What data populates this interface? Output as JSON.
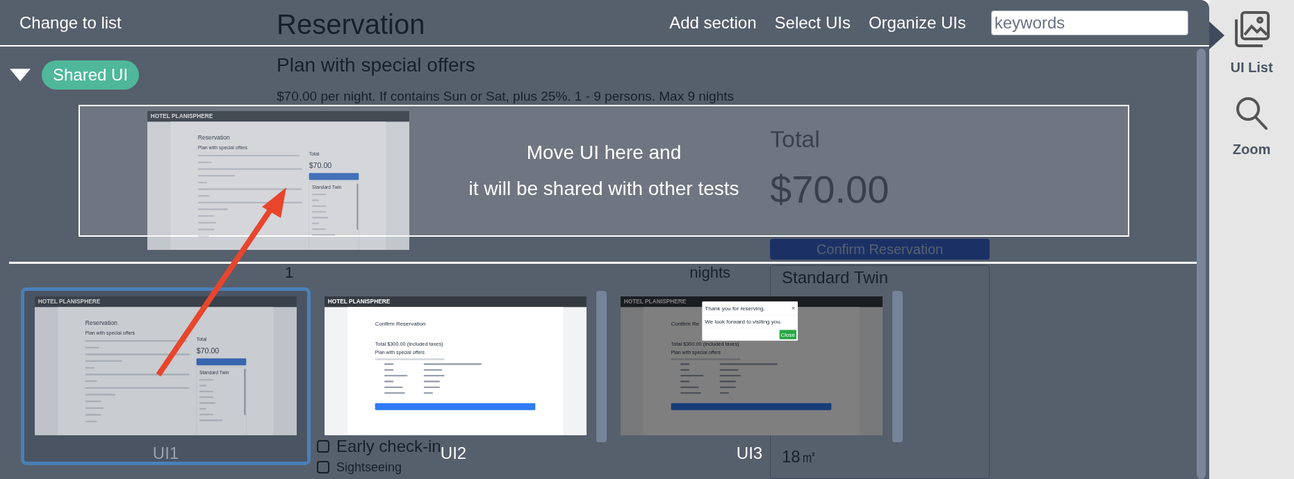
{
  "background_page": {
    "title": "Reservation",
    "plan": "Plan with special offers",
    "description": "$70.00 per night. If contains Sun or Sat, plus 25%. 1 - 9 persons. Max 9 nights",
    "stay": {
      "value": "1",
      "unit": "nights"
    },
    "plans": [
      {
        "label": "Early check-in",
        "checked": false
      },
      {
        "label": "Sightseeing",
        "checked": false
      }
    ],
    "total_label": "Total",
    "total": "$70.00",
    "button": "Confirm Reservation",
    "room": {
      "name": "Standard Twin",
      "area": "18㎡"
    }
  },
  "toolbar": {
    "toggle_view": "Change to list",
    "actions": [
      "Add section",
      "Select UIs",
      "Organize UIs"
    ],
    "search": {
      "placeholder": "keywords"
    }
  },
  "section": {
    "expanded": true,
    "tag": "Shared UI",
    "drop_zone": [
      "Move UI here and",
      "it will be shared with other tests"
    ]
  },
  "dragged_ui": {
    "kind": "reservation",
    "dimmed": true,
    "header": "HOTEL PLANISPHERE",
    "title": "Reservation",
    "plan": "Plan with special offers",
    "total_label": "Total",
    "total": "$70.00",
    "room_name": "Standard Twin"
  },
  "uis": [
    {
      "label": "UI1",
      "selected": true,
      "screenshot": {
        "kind": "reservation",
        "dimmed": true,
        "header": "HOTEL PLANISPHERE",
        "title": "Reservation",
        "plan": "Plan with special offers",
        "total_label": "Total",
        "total": "$70.00",
        "room_name": "Standard Twin"
      }
    },
    {
      "label": "UI2",
      "selected": false,
      "screenshot": {
        "kind": "confirm",
        "header": "HOTEL PLANISPHERE",
        "title": "Confirm Reservation",
        "total": "Total $300.00 (included taxes)",
        "plan": "Plan with special offers"
      }
    },
    {
      "label": "UI3",
      "selected": false,
      "screenshot": {
        "kind": "confirm",
        "header": "HOTEL PLANISPHERE",
        "title": "Confirm Re",
        "total": "Total $300.00 (included taxes)",
        "plan": "Plan with special offers",
        "modal": {
          "title": "Thank you for reserving.",
          "close": "×",
          "body": "We look forward to visiting you.",
          "button": "Close"
        }
      }
    }
  ],
  "sidebar": {
    "items": [
      {
        "kind": "list",
        "label": "UI List"
      },
      {
        "kind": "zoom",
        "label": "Zoom"
      }
    ]
  }
}
